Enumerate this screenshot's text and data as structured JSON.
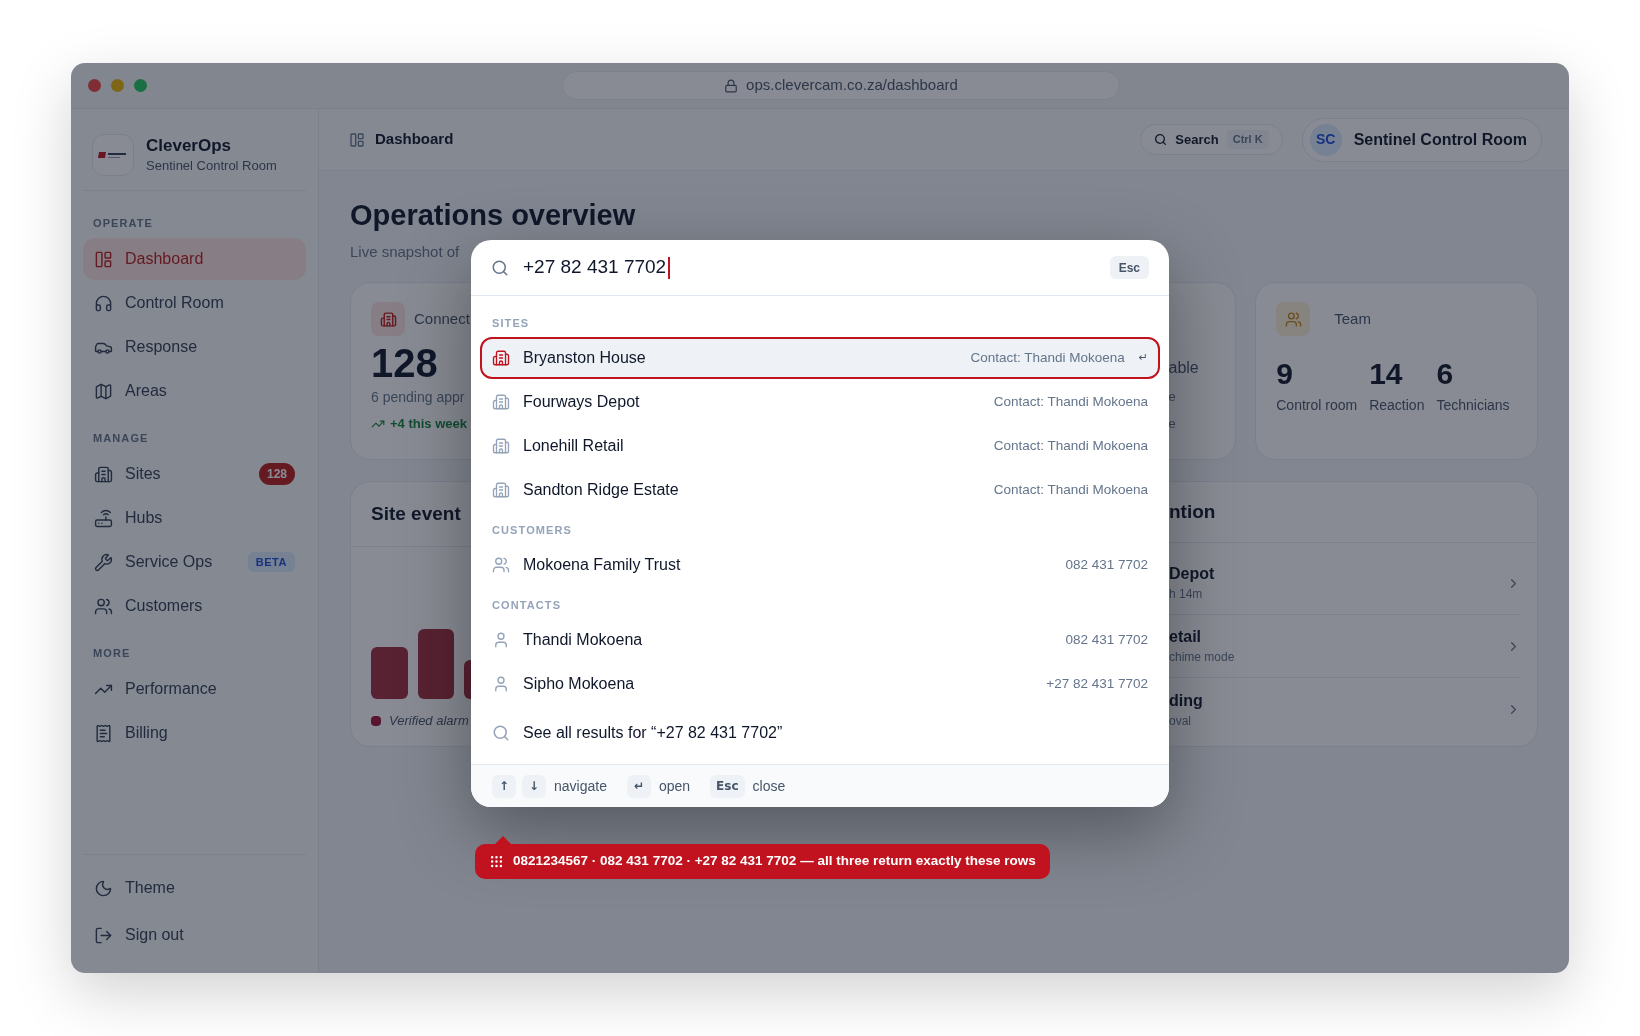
{
  "browser": {
    "url": "ops.clevercam.co.za/dashboard"
  },
  "sidebar": {
    "brand": {
      "name": "CleverOps",
      "subtitle": "Sentinel Control Room"
    },
    "sections": [
      {
        "label": "OPERATE",
        "items": [
          {
            "label": "Dashboard",
            "selected": true
          },
          {
            "label": "Control Room",
            "selected": false
          },
          {
            "label": "Response",
            "selected": false
          },
          {
            "label": "Areas",
            "selected": false
          }
        ]
      },
      {
        "label": "MANAGE",
        "items": [
          {
            "label": "Sites",
            "selected": false,
            "badge": {
              "kind": "count",
              "text": "128"
            }
          },
          {
            "label": "Hubs",
            "selected": false
          },
          {
            "label": "Service Ops",
            "selected": false,
            "badge": {
              "kind": "tag",
              "text": "BETA"
            }
          },
          {
            "label": "Customers",
            "selected": false
          }
        ]
      },
      {
        "label": "MORE",
        "items": [
          {
            "label": "Performance",
            "selected": false
          },
          {
            "label": "Billing",
            "selected": false
          }
        ]
      }
    ],
    "footer_items": [
      {
        "label": "Theme"
      },
      {
        "label": "Sign out"
      }
    ]
  },
  "header": {
    "breadcrumb": "Dashboard",
    "search": {
      "label": "Search",
      "shortcut": "Ctrl K"
    },
    "user": {
      "initials": "SC",
      "name": "Sentinel Control Room"
    }
  },
  "page": {
    "title": "Operations overview",
    "subtitle": "Live snapshot of",
    "sites_card": {
      "label": "Connect",
      "value": "128",
      "note": "6 pending appr",
      "trend": "+4 this week"
    },
    "status_card": {
      "lines": [
        "able",
        "e",
        "e"
      ]
    },
    "team_card": {
      "label": "Team",
      "stats": [
        {
          "value": "9",
          "label": "Control room"
        },
        {
          "value": "14",
          "label": "Reaction"
        },
        {
          "value": "6",
          "label": "Technicians"
        }
      ]
    },
    "events_card": {
      "title": "Site event",
      "legend": "Verified alarm"
    },
    "attention_card": {
      "title": "ntion",
      "rows": [
        {
          "title": "Depot",
          "detail": "h 14m"
        },
        {
          "title": "etail",
          "detail": "chime mode"
        },
        {
          "title": "ding",
          "detail": "oval"
        }
      ]
    }
  },
  "palette": {
    "query": "+27 82 431 7702",
    "esc": "Esc",
    "enter_hint": "↵",
    "groups": [
      {
        "label": "SITES",
        "kind": "site",
        "items": [
          {
            "name": "Bryanston House",
            "detail": "Contact: Thandi Mokoena",
            "selected": true
          },
          {
            "name": "Fourways Depot",
            "detail": "Contact: Thandi Mokoena",
            "selected": false
          },
          {
            "name": "Lonehill Retail",
            "detail": "Contact: Thandi Mokoena",
            "selected": false
          },
          {
            "name": "Sandton Ridge Estate",
            "detail": "Contact: Thandi Mokoena",
            "selected": false
          }
        ]
      },
      {
        "label": "CUSTOMERS",
        "kind": "customer",
        "items": [
          {
            "name": "Mokoena Family Trust",
            "detail": "082 431 7702",
            "selected": false
          }
        ]
      },
      {
        "label": "CONTACTS",
        "kind": "contact",
        "items": [
          {
            "name": "Thandi Mokoena",
            "detail": "082 431 7702",
            "selected": false
          },
          {
            "name": "Sipho Mokoena",
            "detail": "+27 82 431 7702",
            "selected": false
          }
        ]
      }
    ],
    "see_all": "See all results for “+27 82 431 7702”",
    "footer": [
      {
        "keys": [
          "↑",
          "↓"
        ],
        "label": "navigate"
      },
      {
        "keys": [
          "↵"
        ],
        "label": "open"
      },
      {
        "keys": [
          "Esc"
        ],
        "label": "close"
      }
    ]
  },
  "hint": "0821234567 · 082 431 7702 · +27 82 431 7702 — all three return exactly these rows"
}
